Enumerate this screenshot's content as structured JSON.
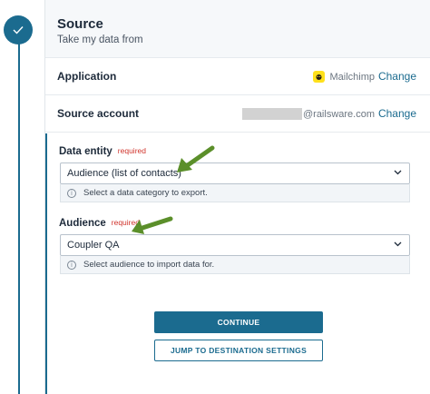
{
  "step": {
    "status_icon": "check-icon"
  },
  "source": {
    "title": "Source",
    "subtitle": "Take my data from",
    "application": {
      "label": "Application",
      "value": "Mailchimp",
      "icon": "mailchimp-logo-icon",
      "change": "Change"
    },
    "account": {
      "label": "Source account",
      "value": "@railsware.com",
      "change": "Change"
    }
  },
  "data_entity": {
    "label": "Data entity",
    "required": "required",
    "value": "Audience (list of contacts)",
    "hint": "Select a data category to export."
  },
  "audience": {
    "label": "Audience",
    "required": "required",
    "value": "Coupler QA",
    "hint": "Select audience to import data for."
  },
  "buttons": {
    "continue": "CONTINUE",
    "jump": "JUMP TO DESTINATION SETTINGS"
  },
  "colors": {
    "accent": "#1b6b8f",
    "required": "#d0342c",
    "annotation_arrow": "#5b8f2a"
  }
}
